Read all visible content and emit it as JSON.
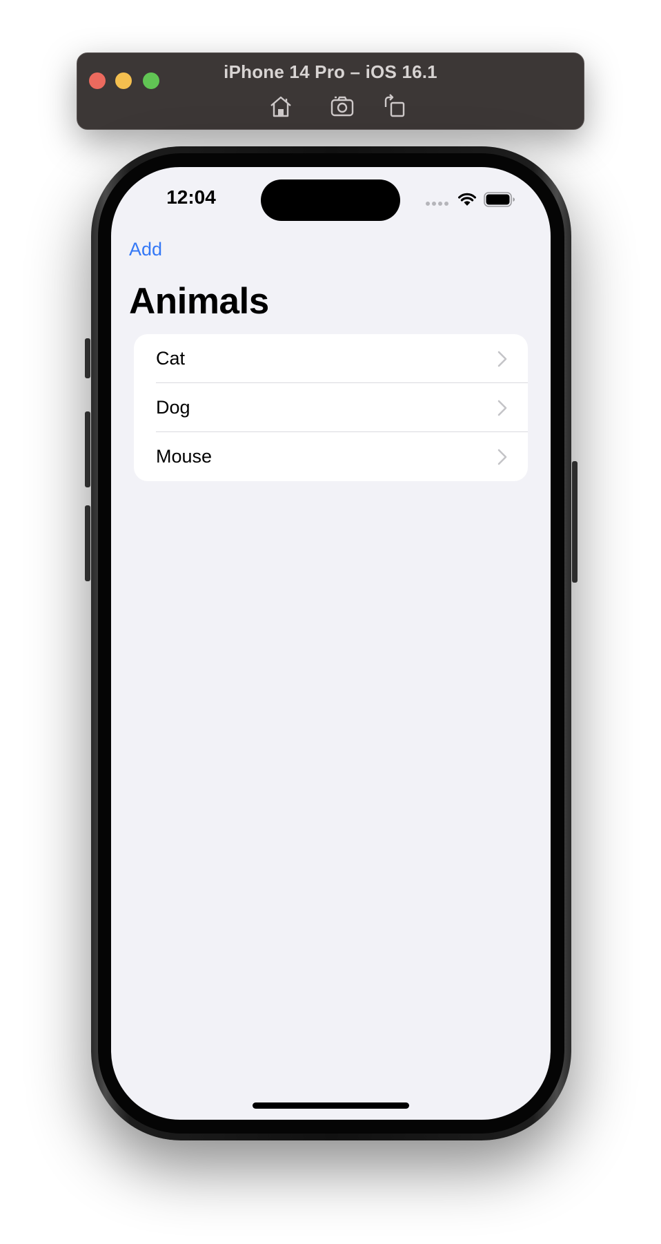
{
  "simulator": {
    "title": "iPhone 14 Pro – iOS 16.1",
    "toolbar_icons": [
      "home-icon",
      "screenshot-icon",
      "rotate-icon"
    ]
  },
  "status_bar": {
    "time": "12:04",
    "icons": [
      "cellular-signal-icon",
      "wifi-icon",
      "battery-icon"
    ]
  },
  "nav": {
    "add_label": "Add",
    "title": "Animals"
  },
  "list": {
    "items": [
      {
        "label": "Cat"
      },
      {
        "label": "Dog"
      },
      {
        "label": "Mouse"
      }
    ]
  },
  "colors": {
    "accent": "#3478f6",
    "background": "#f2f2f7",
    "row_background": "#ffffff",
    "chevron": "#c4c4c7",
    "toolbar": "#3c3736"
  }
}
